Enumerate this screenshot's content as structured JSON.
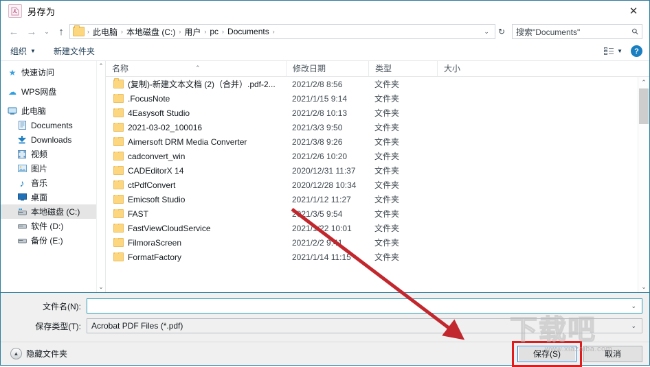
{
  "window": {
    "title": "另存为",
    "title_icon": "pdf-icon",
    "close_label": "✕"
  },
  "nav": {
    "back_icon": "arrow-left-icon",
    "forward_icon": "arrow-right-icon",
    "history_icon": "chevron-down-icon",
    "up_icon": "arrow-up-icon",
    "refresh_icon": "refresh-icon",
    "refresh_glyph": "↻",
    "dropdown_glyph": "⌄",
    "breadcrumbs": [
      "此电脑",
      "本地磁盘 (C:)",
      "用户",
      "pc",
      "Documents"
    ],
    "separator": "›"
  },
  "search": {
    "placeholder": "搜索\"Documents\"",
    "icon": "search-icon",
    "glyph": "⚲"
  },
  "toolbar": {
    "organize_label": "组织",
    "organize_caret": "▼",
    "new_folder_label": "新建文件夹",
    "view_icon": "view-mode-icon",
    "view_caret": "▼",
    "help_label": "?"
  },
  "sidebar": {
    "items": [
      {
        "label": "快速访问",
        "icon": "star-icon",
        "glyph": "★",
        "color": "#3aa0dd",
        "level": 0,
        "selected": false
      },
      {
        "label": "WPS网盘",
        "icon": "cloud-icon",
        "glyph": "☁",
        "color": "#2f9fe0",
        "level": 0,
        "selected": false
      },
      {
        "label": "此电脑",
        "icon": "computer-icon",
        "glyph": "🖥",
        "color": "#2a7fb8",
        "level": 0,
        "selected": false
      },
      {
        "label": "Documents",
        "icon": "documents-icon",
        "glyph": "▤",
        "color": "#5a8fbf",
        "level": 1,
        "selected": false
      },
      {
        "label": "Downloads",
        "icon": "downloads-icon",
        "glyph": "⬇",
        "color": "#1e7fc4",
        "level": 1,
        "selected": false
      },
      {
        "label": "视频",
        "icon": "video-icon",
        "glyph": "▦",
        "color": "#4e86b8",
        "level": 1,
        "selected": false
      },
      {
        "label": "图片",
        "icon": "pictures-icon",
        "glyph": "▣",
        "color": "#63a2cd",
        "level": 1,
        "selected": false
      },
      {
        "label": "音乐",
        "icon": "music-icon",
        "glyph": "♪",
        "color": "#1e7fc4",
        "level": 1,
        "selected": false
      },
      {
        "label": "桌面",
        "icon": "desktop-icon",
        "glyph": "▬",
        "color": "#2070b8",
        "level": 1,
        "selected": false
      },
      {
        "label": "本地磁盘 (C:)",
        "icon": "disk-icon",
        "glyph": "▰",
        "color": "#5a8fbf",
        "level": 1,
        "selected": true
      },
      {
        "label": "软件 (D:)",
        "icon": "disk-icon",
        "glyph": "▰",
        "color": "#808b93",
        "level": 1,
        "selected": false
      },
      {
        "label": "备份 (E:)",
        "icon": "disk-icon",
        "glyph": "▰",
        "color": "#808b93",
        "level": 1,
        "selected": false
      }
    ],
    "scroll_up": "⌃",
    "scroll_down": "⌄"
  },
  "filelist": {
    "columns": [
      "名称",
      "修改日期",
      "类型",
      "大小"
    ],
    "sort_caret": "⌃",
    "rows": [
      {
        "name": "(复制)-新建文本文档 (2)（合并）.pdf-2...",
        "date": "2021/2/8 8:56",
        "type": "文件夹",
        "size": ""
      },
      {
        "name": ".FocusNote",
        "date": "2021/1/15 9:14",
        "type": "文件夹",
        "size": ""
      },
      {
        "name": "4Easysoft Studio",
        "date": "2021/2/8 10:13",
        "type": "文件夹",
        "size": ""
      },
      {
        "name": "2021-03-02_100016",
        "date": "2021/3/3 9:50",
        "type": "文件夹",
        "size": ""
      },
      {
        "name": "Aimersoft DRM Media Converter",
        "date": "2021/3/8 9:26",
        "type": "文件夹",
        "size": ""
      },
      {
        "name": "cadconvert_win",
        "date": "2021/2/6 10:20",
        "type": "文件夹",
        "size": ""
      },
      {
        "name": "CADEditorX 14",
        "date": "2020/12/31 11:37",
        "type": "文件夹",
        "size": ""
      },
      {
        "name": "ctPdfConvert",
        "date": "2020/12/28 10:34",
        "type": "文件夹",
        "size": ""
      },
      {
        "name": "Emicsoft Studio",
        "date": "2021/1/12 11:27",
        "type": "文件夹",
        "size": ""
      },
      {
        "name": "FAST",
        "date": "2021/3/5 9:54",
        "type": "文件夹",
        "size": ""
      },
      {
        "name": "FastViewCloudService",
        "date": "2021/1/22 10:01",
        "type": "文件夹",
        "size": ""
      },
      {
        "name": "FilmoraScreen",
        "date": "2021/2/2 9:41",
        "type": "文件夹",
        "size": ""
      },
      {
        "name": "FormatFactory",
        "date": "2021/1/14 11:15",
        "type": "文件夹",
        "size": ""
      }
    ],
    "scroll_up": "⌃",
    "scroll_down": "⌄"
  },
  "form": {
    "filename_label": "文件名(N):",
    "filename_value": "",
    "filetype_label": "保存类型(T):",
    "filetype_value": "Acrobat PDF Files (*.pdf)",
    "dropdown_glyph": "⌄"
  },
  "actions": {
    "hide_folders_label": "隐藏文件夹",
    "hide_folders_icon": "chevron-up-circle-icon",
    "hide_folders_glyph": "▲",
    "save_label": "保存(S)",
    "cancel_label": "取消"
  },
  "annotations": {
    "highlight_color": "#e01b1b",
    "arrow_color": "#c1272d",
    "arrow_from": "425,305",
    "arrow_to": "672,492"
  },
  "watermark": {
    "text": "下载吧",
    "url": "www.xiazaiba.com"
  }
}
